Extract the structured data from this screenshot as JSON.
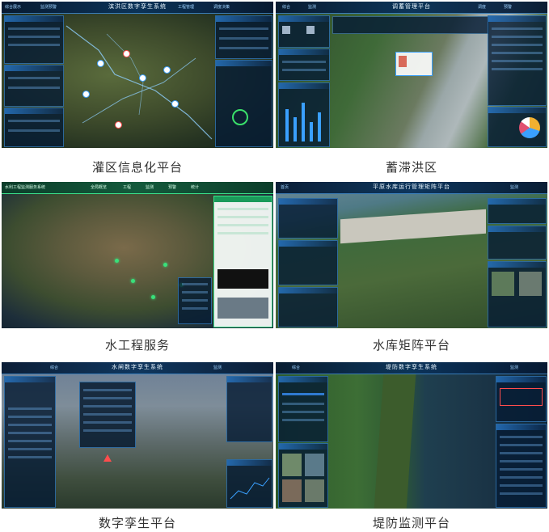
{
  "tiles": [
    {
      "caption": "灌区信息化平台",
      "title": "滨洪区数字孪生系统",
      "nav": [
        "综合展示",
        "监测预警",
        "水资源",
        "工程管理",
        "调度决策"
      ]
    },
    {
      "caption": "蓄滞洪区",
      "title": "调蓄管理平台",
      "nav": [
        "综合",
        "监测",
        "调度",
        "预警"
      ]
    },
    {
      "caption": "水工程服务",
      "title": "水利工程监测服务系统",
      "nav": [
        "全局概览",
        "工程",
        "监测",
        "预警",
        "统计"
      ]
    },
    {
      "caption": "水库矩阵平台",
      "title": "平原水库运行管理矩阵平台",
      "nav": [
        "首页",
        "监测",
        "巡查"
      ]
    },
    {
      "caption": "数字孪生平台",
      "title": "水闸数字孪生系统",
      "nav": [
        "综合",
        "监测",
        "预警",
        "调度"
      ]
    },
    {
      "caption": "堤防监测平台",
      "title": "堤防数字孪生系统",
      "nav": [
        "综合",
        "监测",
        "巡查"
      ]
    }
  ],
  "colors": {
    "accent": "#3aa0ff",
    "frame": "#0b2238",
    "alert": "#ff4d4d"
  }
}
